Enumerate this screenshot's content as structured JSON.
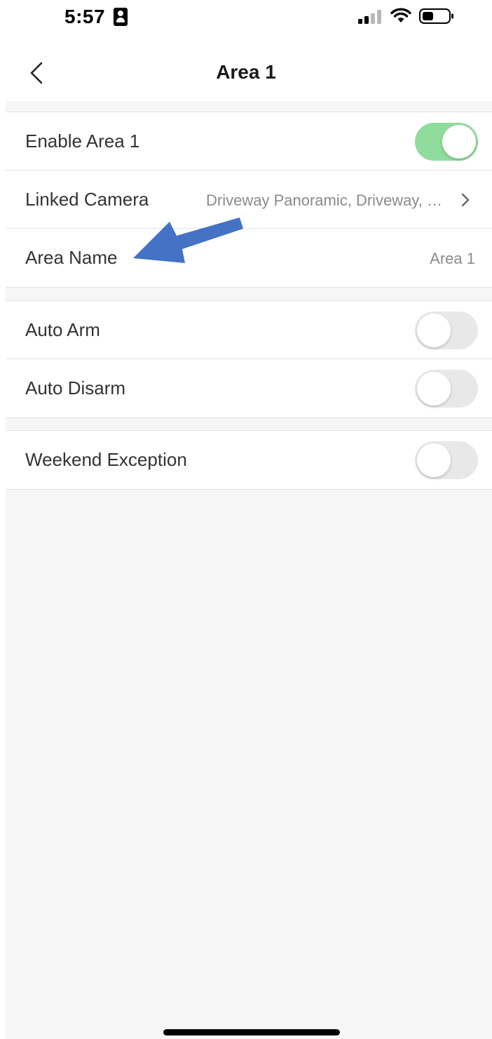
{
  "status_bar": {
    "time": "5:57",
    "icons": [
      "contact-card-icon",
      "cellular-signal-icon",
      "wifi-icon",
      "battery-icon"
    ]
  },
  "nav": {
    "title": "Area 1",
    "back_icon": "chevron-left-icon"
  },
  "sections": [
    {
      "rows": [
        {
          "label": "Enable Area 1",
          "control": "toggle",
          "on": true
        },
        {
          "label": "Linked Camera",
          "value": "Driveway Panoramic, Driveway, Garage",
          "control": "chevron"
        },
        {
          "label": "Area Name",
          "value": "Area 1",
          "control": "none"
        }
      ]
    },
    {
      "rows": [
        {
          "label": "Auto Arm",
          "control": "toggle",
          "on": false
        },
        {
          "label": "Auto Disarm",
          "control": "toggle",
          "on": false
        }
      ]
    },
    {
      "rows": [
        {
          "label": "Weekend Exception",
          "control": "toggle",
          "on": false
        }
      ]
    }
  ],
  "colors": {
    "toggle_on": "#8fdc9c",
    "toggle_off": "#e8e8e8",
    "annotation_arrow": "#4472c4",
    "page_background": "#f6f6f6"
  }
}
